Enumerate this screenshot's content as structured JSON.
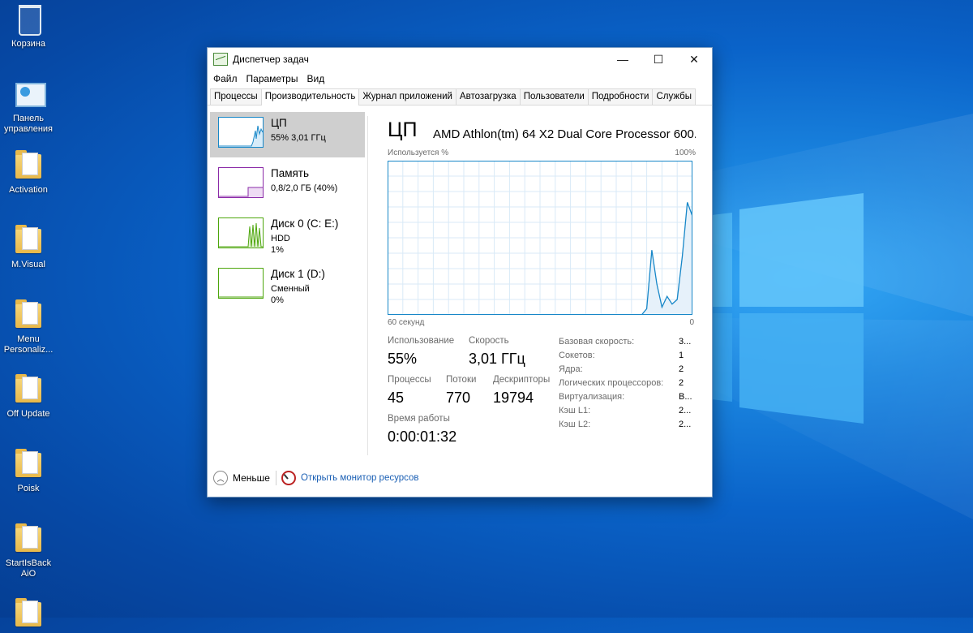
{
  "desktop": {
    "icons": [
      {
        "label": "Корзина",
        "icon": "recycle-bin-icon"
      },
      {
        "label": "Панель управления",
        "icon": "control-panel-icon"
      },
      {
        "label": "Activation",
        "icon": "folder-icon"
      },
      {
        "label": "M.Visual",
        "icon": "folder-icon"
      },
      {
        "label": "Menu Personaliz...",
        "icon": "folder-icon"
      },
      {
        "label": "Off Update",
        "icon": "folder-icon"
      },
      {
        "label": "Poisk",
        "icon": "folder-icon"
      },
      {
        "label": "StartIsBack AiO",
        "icon": "folder-icon"
      }
    ]
  },
  "window": {
    "title": "Диспетчер задач",
    "controls": {
      "minimize": "—",
      "maximize": "☐",
      "close": "✕"
    },
    "menu": [
      "Файл",
      "Параметры",
      "Вид"
    ],
    "tabs": [
      "Процессы",
      "Производительность",
      "Журнал приложений",
      "Автозагрузка",
      "Пользователи",
      "Подробности",
      "Службы"
    ],
    "active_tab": "Производительность"
  },
  "resources": [
    {
      "name": "ЦП",
      "sub1": "55% 3,01 ГГц",
      "sub2": "",
      "color": "#1787c8",
      "selected": true
    },
    {
      "name": "Память",
      "sub1": "0,8/2,0 ГБ (40%)",
      "sub2": "",
      "color": "#8b2ba8",
      "selected": false
    },
    {
      "name": "Диск 0 (C: E:)",
      "sub1": "HDD",
      "sub2": "1%",
      "color": "#4da60c",
      "selected": false
    },
    {
      "name": "Диск 1 (D:)",
      "sub1": "Сменный",
      "sub2": "0%",
      "color": "#4da60c",
      "selected": false
    }
  ],
  "cpu": {
    "title": "ЦП",
    "model": "AMD Athlon(tm) 64 X2 Dual Core Processor 600...",
    "axis_top_left": "Используется %",
    "axis_top_right": "100%",
    "axis_bottom_left": "60 секунд",
    "axis_bottom_right": "0",
    "usage_label": "Использование",
    "usage_value": "55%",
    "speed_label": "Скорость",
    "speed_value": "3,01 ГГц",
    "processes_label": "Процессы",
    "processes_value": "45",
    "threads_label": "Потоки",
    "threads_value": "770",
    "handles_label": "Дескрипторы",
    "handles_value": "19794",
    "uptime_label": "Время работы",
    "uptime_value": "0:00:01:32",
    "details": [
      {
        "label": "Базовая скорость:",
        "value": "3..."
      },
      {
        "label": "Сокетов:",
        "value": "1"
      },
      {
        "label": "Ядра:",
        "value": "2"
      },
      {
        "label": "Логических процессоров:",
        "value": "2"
      },
      {
        "label": "Виртуализация:",
        "value": "В..."
      },
      {
        "label": "Кэш L1:",
        "value": "2..."
      },
      {
        "label": "Кэш L2:",
        "value": "2..."
      }
    ],
    "graph_color": "#1787c8"
  },
  "chart_data": {
    "type": "area",
    "x": [
      60,
      58,
      56,
      54,
      52,
      50,
      48,
      46,
      44,
      42,
      40,
      38,
      36,
      34,
      32,
      30,
      28,
      26,
      24,
      22,
      20,
      18,
      16,
      14,
      12,
      10,
      9,
      8,
      7,
      6,
      5,
      4,
      3,
      2,
      1,
      0
    ],
    "values": [
      0,
      0,
      0,
      0,
      0,
      0,
      0,
      0,
      0,
      0,
      0,
      0,
      0,
      0,
      0,
      0,
      0,
      0,
      0,
      0,
      0,
      0,
      0,
      0,
      0,
      0,
      4,
      42,
      20,
      5,
      12,
      7,
      10,
      38,
      73,
      64
    ],
    "ylim": [
      0,
      100
    ],
    "xlabel": "60 секунд",
    "ylabel": "Используется %"
  },
  "footer": {
    "less_label": "Меньше",
    "resmon_label": "Открыть монитор ресурсов"
  }
}
